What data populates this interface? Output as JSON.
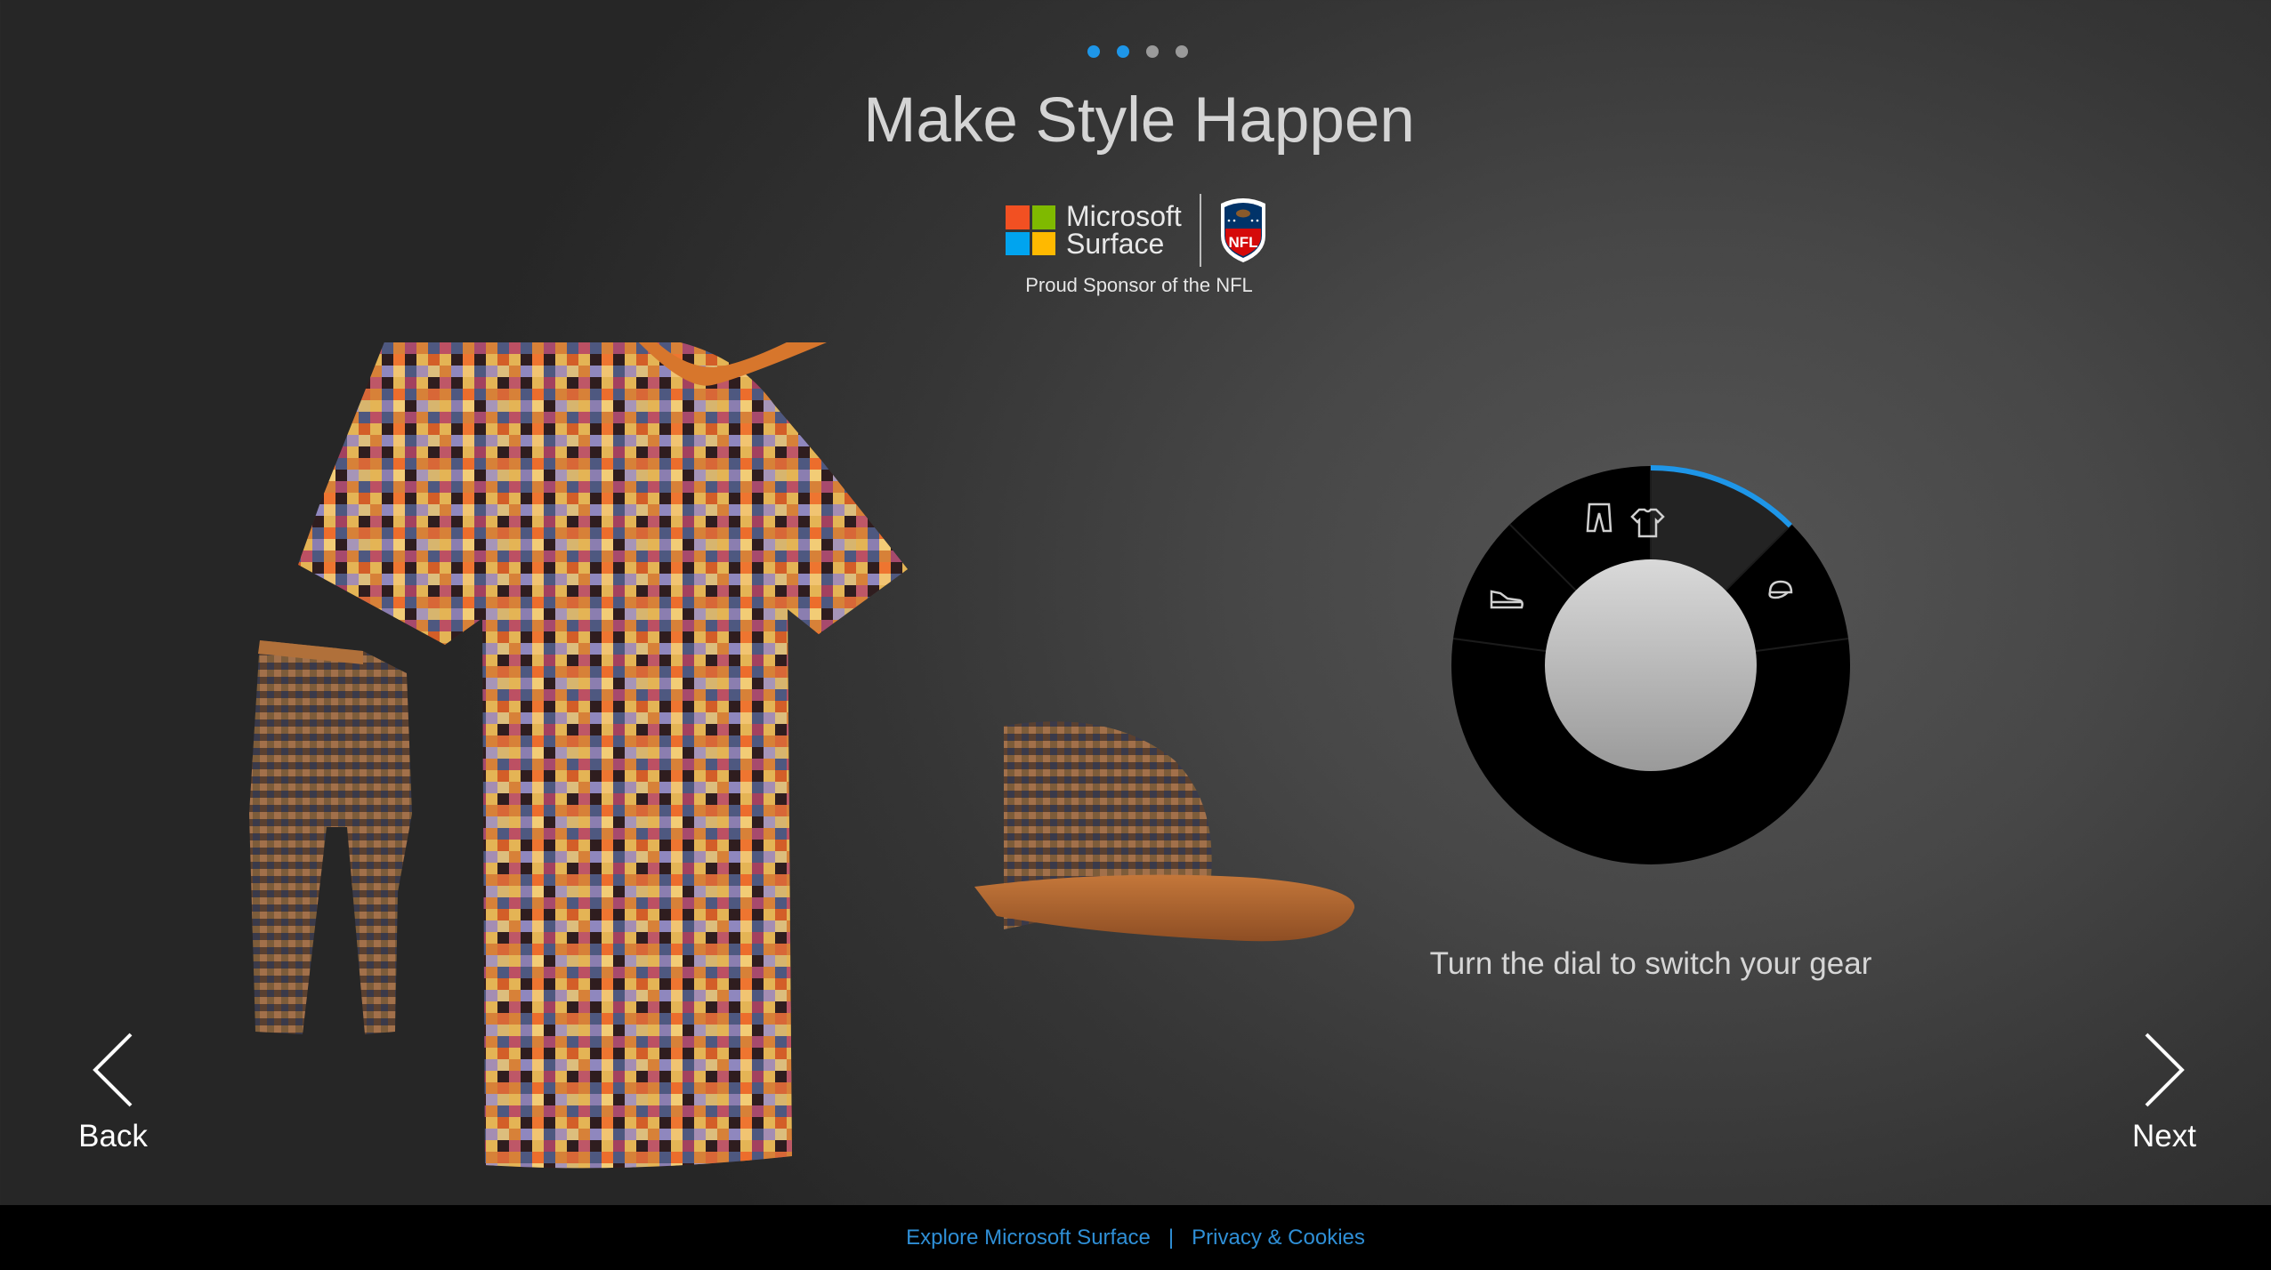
{
  "pager": {
    "total": 4,
    "active_indices": [
      0,
      1
    ]
  },
  "page": {
    "title": "Make Style Happen"
  },
  "branding": {
    "microsoft_line1": "Microsoft",
    "microsoft_line2": "Surface",
    "ms_colors": [
      "#f25022",
      "#7fba00",
      "#00a4ef",
      "#ffb900"
    ],
    "nfl_logo_text": "NFL",
    "sponsor_text": "Proud Sponsor of the NFL"
  },
  "gear": {
    "items": [
      "pants",
      "t-shirt",
      "cap"
    ],
    "accent_color": "#c66a26"
  },
  "dial": {
    "segments": [
      {
        "name": "sneaker-icon",
        "active": false
      },
      {
        "name": "pants-icon",
        "active": false
      },
      {
        "name": "tshirt-icon",
        "active": true
      },
      {
        "name": "cap-icon",
        "active": false
      }
    ],
    "accent_color": "#1e96e8",
    "caption": "Turn the dial to switch your gear"
  },
  "nav": {
    "back_label": "Back",
    "next_label": "Next",
    "back_icon": "chevron-left-icon",
    "next_icon": "chevron-right-icon"
  },
  "footer": {
    "link1": "Explore Microsoft Surface",
    "separator": "|",
    "link2": "Privacy & Cookies",
    "link_color": "#2f8fd6"
  }
}
